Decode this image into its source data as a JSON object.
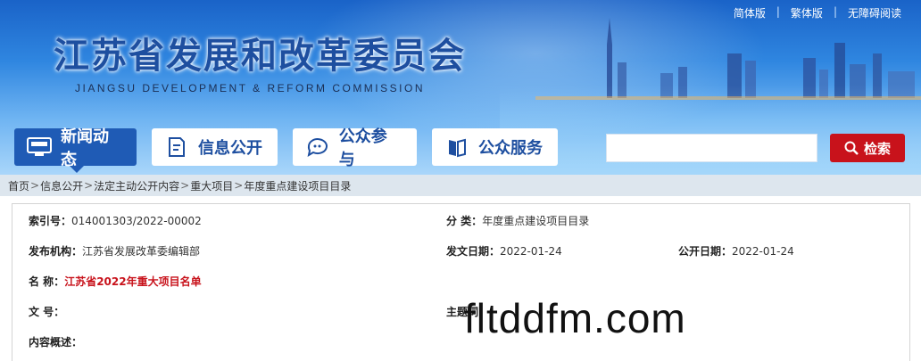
{
  "top_links": [
    "简体版",
    "繁体版",
    "无障碍阅读"
  ],
  "logo": {
    "title_zh": "江苏省发展和改革委员会",
    "title_en": "JIANGSU DEVELOPMENT & REFORM COMMISSION"
  },
  "nav": [
    {
      "label": "新闻动态",
      "icon": "news-icon",
      "active": true
    },
    {
      "label": "信息公开",
      "icon": "document-icon",
      "active": false
    },
    {
      "label": "公众参与",
      "icon": "chat-icon",
      "active": false
    },
    {
      "label": "公众服务",
      "icon": "book-icon",
      "active": false
    }
  ],
  "search": {
    "placeholder": "",
    "button_label": "检索",
    "icon": "search-icon"
  },
  "breadcrumb": [
    "首页",
    "信息公开",
    "法定主动公开内容",
    "重大项目",
    "年度重点建设项目目录"
  ],
  "info": {
    "index_label": "索引号：",
    "index_value": "014001303/2022-00002",
    "category_label": "分  类：",
    "category_value": "年度重点建设项目目录",
    "publisher_label": "发布机构：",
    "publisher_value": "江苏省发展改革委编辑部",
    "issue_date_label": "发文日期：",
    "issue_date_value": "2022-01-24",
    "public_date_label": "公开日期：",
    "public_date_value": "2022-01-24",
    "name_label": "名  称：",
    "name_value": "江苏省2022年重大项目名单",
    "doc_no_label": "文  号：",
    "doc_no_value": "",
    "subject_label": "主题词：",
    "subject_value": "",
    "summary_label": "内容概述：",
    "summary_value": ""
  },
  "watermark": "fltddfm.com",
  "colors": {
    "brand_blue": "#1f5bb5",
    "accent_red": "#c8121b",
    "breadcrumb_bg": "#dde6ee"
  }
}
